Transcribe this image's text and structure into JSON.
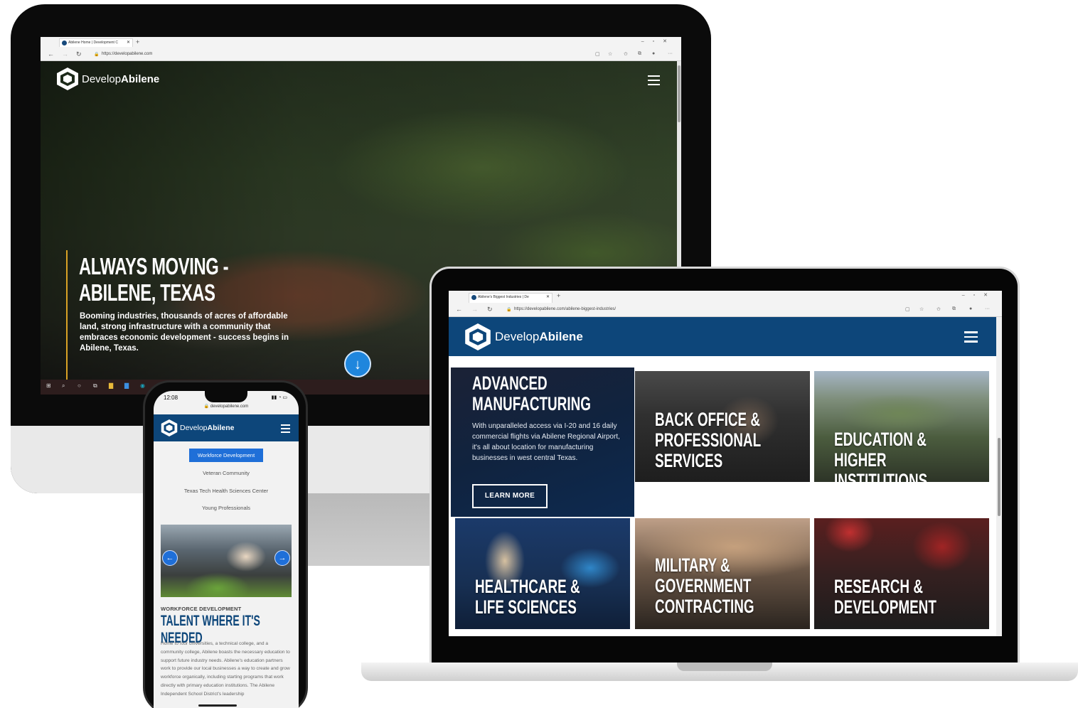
{
  "brand": {
    "name_light": "Develop",
    "name_bold": "Abilene",
    "navy": "#0d467a",
    "accent_blue": "#1f6fd8",
    "gold": "#d9a225"
  },
  "desktop": {
    "tab_title": "Abilene Home | Development C",
    "url": "https://developabilene.com",
    "hero_title": "ALWAYS MOVING - ABILENE, TEXAS",
    "hero_text": "Booming industries, thousands of acres of affordable land, strong infrastructure with a community that embraces economic development - success begins in Abilene, Texas.",
    "scroll_icon": "arrow-down-icon"
  },
  "laptop": {
    "tab_title": "Abilene's Biggest Industries | De",
    "url": "https://developabilene.com/abilene-biggest-industries/",
    "featured": {
      "title": "ADVANCED MANUFACTURING",
      "text": "With unparalleled access via I-20 and 16 daily commercial flights via Abilene Regional Airport, it's all about location for manufacturing businesses in west central Texas.",
      "button": "LEARN MORE"
    },
    "tiles": [
      {
        "title": "BACK OFFICE & PROFESSIONAL SERVICES"
      },
      {
        "title": "EDUCATION & HIGHER INSTITUTIONS"
      },
      {
        "title": "HEALTHCARE & LIFE SCIENCES"
      },
      {
        "title": "MILITARY & GOVERNMENT CONTRACTING"
      },
      {
        "title": "RESEARCH & DEVELOPMENT"
      }
    ]
  },
  "phone": {
    "time": "12:08",
    "url": "developabilene.com",
    "menu": [
      "Workforce Development",
      "Veteran Community",
      "Texas Tech Health Sciences Center",
      "Young Professionals"
    ],
    "kicker": "WORKFORCE DEVELOPMENT",
    "heading": "TALENT WHERE IT'S NEEDED",
    "body": "Home to four universities, a technical college, and a community college, Abilene boasts the necessary education to support future industry needs. Abilene's education partners work to provide our local businesses a way to create and grow workforce organically, including starting programs that work directly with primary education institutions. The Abilene Independent School District's leadership"
  }
}
